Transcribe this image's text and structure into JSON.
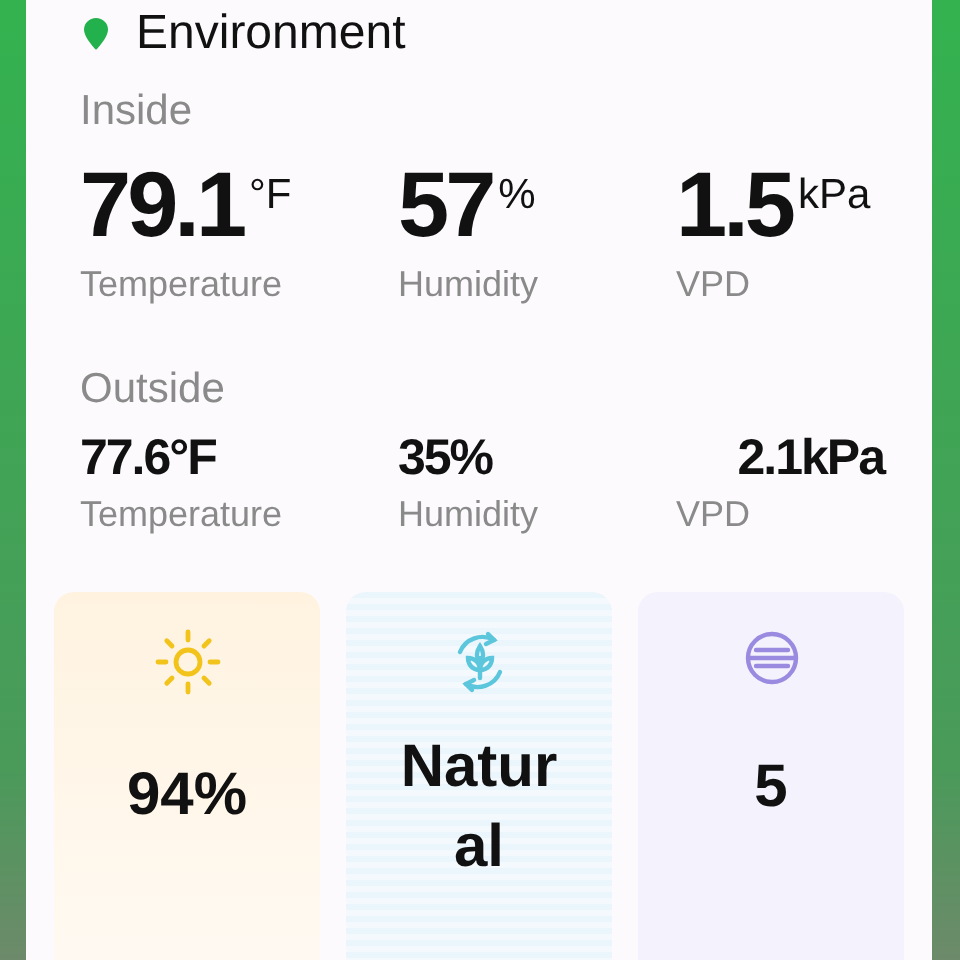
{
  "header": {
    "title": "Environment"
  },
  "inside": {
    "label": "Inside",
    "metrics": [
      {
        "value": "79.1",
        "unit": "°F",
        "label": "Temperature"
      },
      {
        "value": "57",
        "unit": "%",
        "label": "Humidity"
      },
      {
        "value": "1.5",
        "unit": "kPa",
        "label": "VPD"
      }
    ]
  },
  "outside": {
    "label": "Outside",
    "metrics": [
      {
        "value": "77.6°F",
        "label": "Temperature"
      },
      {
        "value": "35%",
        "label": "Humidity"
      },
      {
        "value": "2.1kPa",
        "label": "VPD"
      }
    ]
  },
  "tiles": [
    {
      "kind": "light",
      "value": "94%"
    },
    {
      "kind": "mode",
      "value": "Natural"
    },
    {
      "kind": "fan",
      "value": "5"
    }
  ]
}
